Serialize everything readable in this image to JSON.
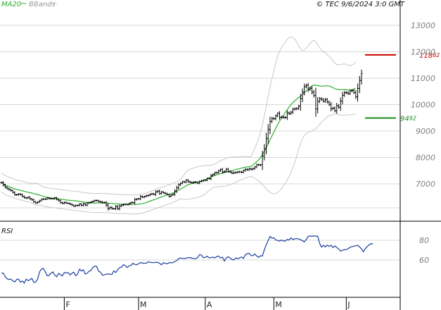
{
  "header": {
    "ma_label": "MA20",
    "bb_label": "BBands",
    "timestamp": "© TEC 9/6/2024 3:0 GMT"
  },
  "colors": {
    "ma": "#2eae2e",
    "bbands": "#c8c8c8",
    "price": "#000000",
    "rsi": "#1a3e9c",
    "resistance": "#cc0000",
    "support": "#1a8a1a",
    "grid": "#d9d9d9"
  },
  "chart_data": [
    {
      "type": "ohlc",
      "title": "",
      "ylim": [
        6000,
        13500
      ],
      "y_ticks": [
        7000,
        8000,
        9000,
        10000,
        11000,
        12000,
        13000
      ],
      "y_tick_labels": [
        "7000",
        "8000",
        "9000",
        "10000",
        "11000",
        "12000",
        "13000"
      ],
      "x_month_labels": [
        "F",
        "M",
        "A",
        "M",
        "J"
      ],
      "x_month_positions": [
        33,
        72,
        107,
        143,
        181
      ],
      "n_bars": 190,
      "close": [
        7050,
        6955,
        6874,
        6818,
        6784,
        6745,
        6677,
        6593,
        6586,
        6617,
        6593,
        6526,
        6478,
        6464,
        6496,
        6434,
        6395,
        6320,
        6279,
        6312,
        6363,
        6419,
        6422,
        6426,
        6464,
        6444,
        6443,
        6438,
        6474,
        6414,
        6367,
        6294,
        6262,
        6300,
        6272,
        6262,
        6232,
        6197,
        6161,
        6187,
        6183,
        6238,
        6185,
        6247,
        6195,
        6274,
        6293,
        6314,
        6344,
        6373,
        6366,
        6334,
        6319,
        6286,
        6295,
        6196,
        6066,
        6114,
        6058,
        6059,
        6147,
        6061,
        6161,
        6196,
        6215,
        6227,
        6220,
        6258,
        6296,
        6287,
        6404,
        6431,
        6436,
        6526,
        6494,
        6524,
        6553,
        6568,
        6610,
        6625,
        6600,
        6698,
        6727,
        6636,
        6693,
        6660,
        6632,
        6594,
        6527,
        6577,
        6611,
        6728,
        6853,
        6964,
        7022,
        7082,
        7071,
        7143,
        7085,
        7060,
        7043,
        7071,
        7059,
        7029,
        7094,
        7113,
        7137,
        7140,
        7202,
        7203,
        7315,
        7359,
        7421,
        7425,
        7496,
        7547,
        7447,
        7473,
        7557,
        7471,
        7446,
        7408,
        7426,
        7433,
        7455,
        7452,
        7441,
        7503,
        7553,
        7533,
        7569,
        7553,
        7577,
        7642,
        7723,
        7716,
        7721,
        8057,
        8340,
        8716,
        9059,
        9364,
        9474,
        9468,
        9575,
        9668,
        9519,
        9530,
        9513,
        9518,
        9687,
        9661,
        9716,
        9826,
        9839,
        9854,
        9939,
        10234,
        10471,
        10675,
        10733,
        10573,
        10620,
        10473,
        10342,
        9836,
        10121,
        10225,
        10194,
        10130,
        10196,
        10100,
        10008,
        9843,
        9870,
        9767,
        9958,
        9897,
        10133,
        10354,
        10455,
        10448,
        10421,
        10520,
        10531,
        10456,
        10298,
        10614,
        10914,
        11175
      ],
      "ma20": [
        7050,
        7002,
        6960,
        6924,
        6896,
        6871,
        6844,
        6814,
        6789,
        6772,
        6755,
        6736,
        6717,
        6698,
        6684,
        6668,
        6652,
        6632,
        6612,
        6600,
        6578,
        6551,
        6529,
        6510,
        6494,
        6479,
        6467,
        6459,
        6453,
        6443,
        6432,
        6421,
        6410,
        6402,
        6391,
        6383,
        6375,
        6369,
        6363,
        6357,
        6348,
        6339,
        6327,
        6318,
        6305,
        6297,
        6289,
        6283,
        6277,
        6275,
        6275,
        6276,
        6279,
        6279,
        6280,
        6277,
        6268,
        6261,
        6256,
        6250,
        6248,
        6239,
        6238,
        6235,
        6236,
        6233,
        6229,
        6226,
        6224,
        6220,
        6222,
        6227,
        6233,
        6245,
        6255,
        6271,
        6296,
        6319,
        6346,
        6374,
        6396,
        6426,
        6456,
        6482,
        6506,
        6529,
        6557,
        6581,
        6604,
        6630,
        6653,
        6687,
        6721,
        6759,
        6799,
        6842,
        6885,
        6930,
        6969,
        6991,
        7012,
        7032,
        7049,
        7069,
        7089,
        7108,
        7129,
        7159,
        7193,
        7224,
        7259,
        7289,
        7318,
        7341,
        7365,
        7388,
        7406,
        7423,
        7447,
        7468,
        7488,
        7505,
        7523,
        7543,
        7561,
        7578,
        7597,
        7614,
        7631,
        7647,
        7650,
        7660,
        7717,
        7781,
        7840,
        7910,
        7999,
        8108,
        8232,
        8369,
        8516,
        8668,
        8815,
        8963,
        9107,
        9253,
        9374,
        9487,
        9591,
        9698,
        9806,
        9910,
        10001,
        10079,
        10147,
        10207,
        10264,
        10322,
        10385,
        10447,
        10514,
        10583,
        10649,
        10708,
        10746,
        10734,
        10719,
        10704,
        10698,
        10702,
        10717,
        10709,
        10702,
        10676,
        10642,
        10603,
        10585,
        10571,
        10565,
        10568,
        10573,
        10562,
        10549,
        10545,
        10559,
        10590,
        10627
      ]
    },
    {
      "type": "line",
      "title": "RSI",
      "ylim": [
        40,
        90
      ],
      "y_ticks": [
        60,
        80
      ],
      "y_tick_labels": [
        "60",
        "80"
      ],
      "values": [
        46.8,
        46.6,
        43.3,
        40.9,
        40.3,
        40.6,
        38.8,
        37.8,
        40.2,
        40.6,
        37.4,
        38.7,
        36.6,
        40.6,
        39.1,
        39.9,
        41.4,
        37.2,
        37.7,
        40.6,
        47.8,
        50.7,
        51.4,
        48.2,
        44.1,
        44.3,
        46.4,
        47.9,
        44.7,
        43.0,
        46.4,
        45.1,
        43.9,
        47.3,
        46.7,
        47.3,
        44.8,
        46.4,
        47.7,
        43.9,
        46.0,
        50.7,
        48.8,
        50.1,
        45.7,
        46.6,
        48.6,
        49.3,
        52.4,
        53.7,
        53.5,
        48.6,
        47.7,
        44.6,
        44.9,
        45.6,
        45.8,
        45.6,
        45.3,
        48.9,
        47.2,
        50.0,
        52.2,
        52.7,
        55.2,
        54.3,
        52.4,
        54.0,
        54.4,
        56.6,
        55.5,
        55.3,
        56.1,
        57.5,
        56.7,
        56.9,
        56.5,
        58.2,
        57.7,
        57.4,
        57.3,
        57.6,
        57.6,
        56.7,
        55.1,
        57.3,
        56.6,
        56.1,
        57.2,
        57.2,
        57.3,
        58.5,
        59.3,
        61.3,
        61.9,
        61.6,
        61.4,
        61.9,
        62.2,
        62.5,
        61.7,
        61.6,
        61.3,
        62.5,
        65.4,
        65.0,
        62.3,
        62.7,
        63.8,
        62.2,
        62.3,
        62.9,
        62.1,
        63.4,
        64.0,
        61.9,
        62.9,
        58.9,
        62.1,
        63.2,
        62.1,
        60.5,
        60.0,
        62.1,
        61.2,
        62.1,
        63.1,
        61.5,
        65.2,
        66.5,
        66.7,
        64.6,
        64.3,
        66.1,
        64.0,
        62.7,
        64.3,
        64.1,
        70.3,
        75.6,
        79.7,
        83.9,
        82.1,
        82.6,
        80.2,
        79.9,
        79.1,
        80.3,
        79.3,
        79.3,
        80.8,
        80.2,
        82.4,
        80.7,
        81.5,
        81.7,
        81.3,
        80.6,
        79.5,
        78.4,
        80.7,
        83.7,
        84.5,
        83.9,
        84.6,
        84.0,
        84.2,
        76.9,
        73.1,
        75.0,
        73.3,
        75.1,
        73.7,
        75.0,
        72.5,
        74.2,
        72.8,
        71.1,
        69.0,
        69.8,
        70.5,
        70.5,
        71.5,
        72.8,
        73.5,
        74.0,
        74.6,
        74.8,
        73.2,
        71.2,
        68.3,
        71.6,
        73.6,
        75.4,
        76.5,
        76.4
      ]
    }
  ],
  "levels": {
    "resistance": {
      "value": 11882,
      "label_main": "118",
      "label_sup": "82"
    },
    "support": {
      "value": 9492,
      "label_main": "94",
      "label_sup": "92"
    }
  }
}
